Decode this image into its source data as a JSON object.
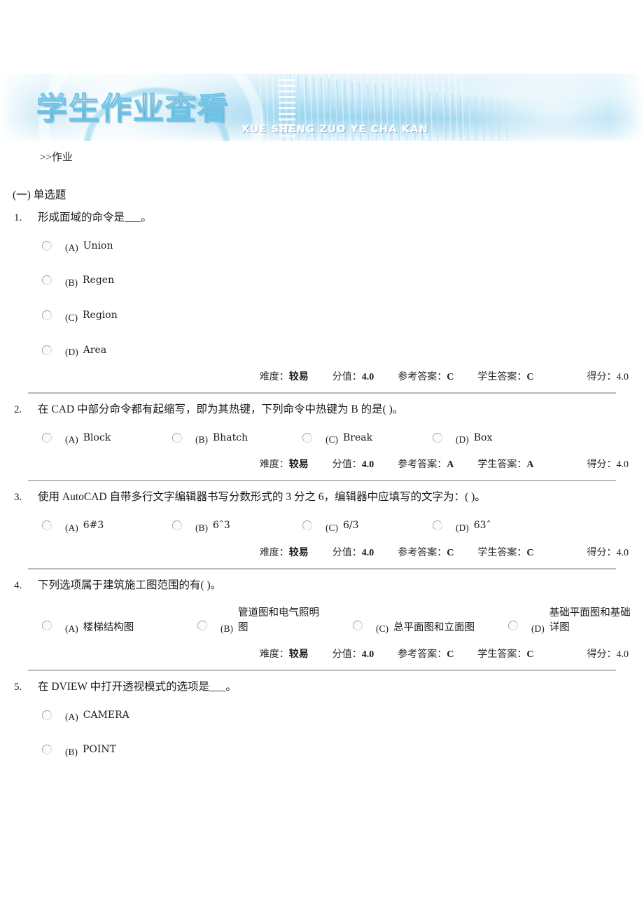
{
  "banner": {
    "title": "学生作业查看",
    "subtitle": "XUE SHENG ZUO YE CHA KAN"
  },
  "breadcrumb": ">>作业",
  "section": {
    "title": "(一) 单选题"
  },
  "meta_labels": {
    "difficulty": "难度：",
    "value": "分值：",
    "reference_answer": "参考答案：",
    "student_answer": "学生答案：",
    "score": "得分："
  },
  "questions": [
    {
      "number": "1.",
      "text": "形成面域的命令是___。",
      "layout": "vertical",
      "options": [
        {
          "letter": "(A)",
          "text": "Union"
        },
        {
          "letter": "(B)",
          "text": "Regen"
        },
        {
          "letter": "(C)",
          "text": "Region"
        },
        {
          "letter": "(D)",
          "text": "Area"
        }
      ],
      "meta": {
        "difficulty": "较易",
        "value": "4.0",
        "reference_answer": "C",
        "student_answer": "C",
        "score": "4.0"
      }
    },
    {
      "number": "2.",
      "text": "在 CAD 中部分命令都有起缩写，即为其热键，下列命令中热键为 B 的是( )。",
      "layout": "row4",
      "options": [
        {
          "letter": "(A)",
          "text": "Block"
        },
        {
          "letter": "(B)",
          "text": "Bhatch"
        },
        {
          "letter": "(C)",
          "text": "Break"
        },
        {
          "letter": "(D)",
          "text": "Box"
        }
      ],
      "meta": {
        "difficulty": "较易",
        "value": "4.0",
        "reference_answer": "A",
        "student_answer": "A",
        "score": "4.0"
      }
    },
    {
      "number": "3.",
      "text": "使用 AutoCAD 自带多行文字编辑器书写分数形式的 3 分之 6，编辑器中应填写的文字为：( )。",
      "layout": "row4",
      "options": [
        {
          "letter": "(A)",
          "text": "6#3"
        },
        {
          "letter": "(B)",
          "text": "6ˆ3"
        },
        {
          "letter": "(C)",
          "text": "6/3"
        },
        {
          "letter": "(D)",
          "text": "63ˆ"
        }
      ],
      "meta": {
        "difficulty": "较易",
        "value": "4.0",
        "reference_answer": "C",
        "student_answer": "C",
        "score": "4.0"
      }
    },
    {
      "number": "4.",
      "text": "下列选项属于建筑施工图范围的有( )。",
      "layout": "row4-wide",
      "options": [
        {
          "letter": "(A)",
          "text": "楼梯结构图"
        },
        {
          "letter": "(B)",
          "text": "管道图和电气照明图"
        },
        {
          "letter": "(C)",
          "text": "总平面图和立面图"
        },
        {
          "letter": "(D)",
          "text": "基础平面图和基础详图"
        }
      ],
      "meta": {
        "difficulty": "较易",
        "value": "4.0",
        "reference_answer": "C",
        "student_answer": "C",
        "score": "4.0"
      }
    },
    {
      "number": "5.",
      "text": "在 DVIEW 中打开透视模式的选项是___。",
      "layout": "vertical",
      "options": [
        {
          "letter": "(A)",
          "text": "CAMERA"
        },
        {
          "letter": "(B)",
          "text": "POINT"
        }
      ],
      "meta": null
    }
  ]
}
